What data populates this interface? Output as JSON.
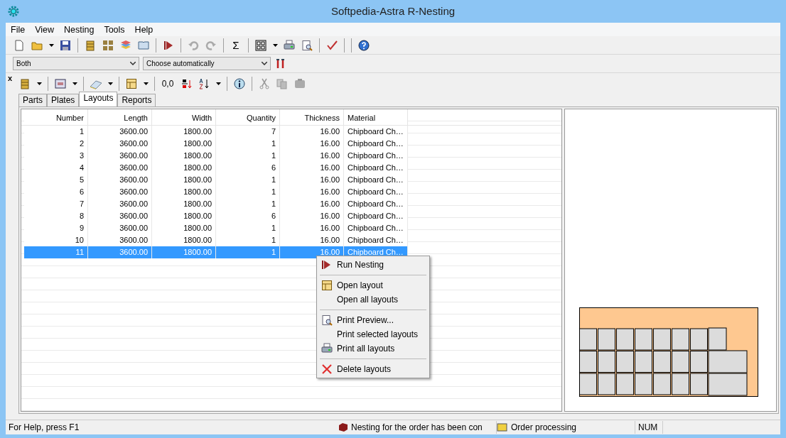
{
  "window": {
    "title": "Softpedia-Astra R-Nesting"
  },
  "menu": [
    "File",
    "View",
    "Nesting",
    "Tools",
    "Help"
  ],
  "toolbar": {
    "sum_glyph": "Σ"
  },
  "filters": [
    {
      "value": "Both"
    },
    {
      "value": "Choose automatically"
    }
  ],
  "panel": {
    "close_glyph": "x",
    "coords_label": "0,0"
  },
  "tabs": [
    {
      "label": "Parts",
      "selected": false
    },
    {
      "label": "Plates",
      "selected": false
    },
    {
      "label": "Layouts",
      "selected": true
    },
    {
      "label": "Reports",
      "selected": false
    }
  ],
  "table": {
    "columns": [
      "Number",
      "Length",
      "Width",
      "Quantity",
      "Thickness",
      "Material"
    ],
    "rows": [
      {
        "cells": [
          "1",
          "3600.00",
          "1800.00",
          "7",
          "16.00",
          "Chipboard Ch…"
        ],
        "selected": false
      },
      {
        "cells": [
          "2",
          "3600.00",
          "1800.00",
          "1",
          "16.00",
          "Chipboard Ch…"
        ],
        "selected": false
      },
      {
        "cells": [
          "3",
          "3600.00",
          "1800.00",
          "1",
          "16.00",
          "Chipboard Ch…"
        ],
        "selected": false
      },
      {
        "cells": [
          "4",
          "3600.00",
          "1800.00",
          "6",
          "16.00",
          "Chipboard Ch…"
        ],
        "selected": false
      },
      {
        "cells": [
          "5",
          "3600.00",
          "1800.00",
          "1",
          "16.00",
          "Chipboard Ch…"
        ],
        "selected": false
      },
      {
        "cells": [
          "6",
          "3600.00",
          "1800.00",
          "1",
          "16.00",
          "Chipboard Ch…"
        ],
        "selected": false
      },
      {
        "cells": [
          "7",
          "3600.00",
          "1800.00",
          "1",
          "16.00",
          "Chipboard Ch…"
        ],
        "selected": false
      },
      {
        "cells": [
          "8",
          "3600.00",
          "1800.00",
          "6",
          "16.00",
          "Chipboard Ch…"
        ],
        "selected": false
      },
      {
        "cells": [
          "9",
          "3600.00",
          "1800.00",
          "1",
          "16.00",
          "Chipboard Ch…"
        ],
        "selected": false
      },
      {
        "cells": [
          "10",
          "3600.00",
          "1800.00",
          "1",
          "16.00",
          "Chipboard Ch…"
        ],
        "selected": false
      },
      {
        "cells": [
          "11",
          "3600.00",
          "1800.00",
          "1",
          "16.00",
          "Chipboard Ch…"
        ],
        "selected": true
      }
    ]
  },
  "context_menu": [
    [
      {
        "label": "Run Nesting"
      }
    ],
    [
      {
        "label": "Open layout"
      },
      {
        "label": "Open all layouts"
      }
    ],
    [
      {
        "label": "Print Preview..."
      },
      {
        "label": "Print selected layouts"
      },
      {
        "label": "Print all layouts"
      }
    ],
    [
      {
        "label": "Delete layouts"
      }
    ]
  ],
  "status_bar": [
    "For Help, press F1",
    "Nesting for the order has been con",
    "Order processing",
    "NUM"
  ]
}
